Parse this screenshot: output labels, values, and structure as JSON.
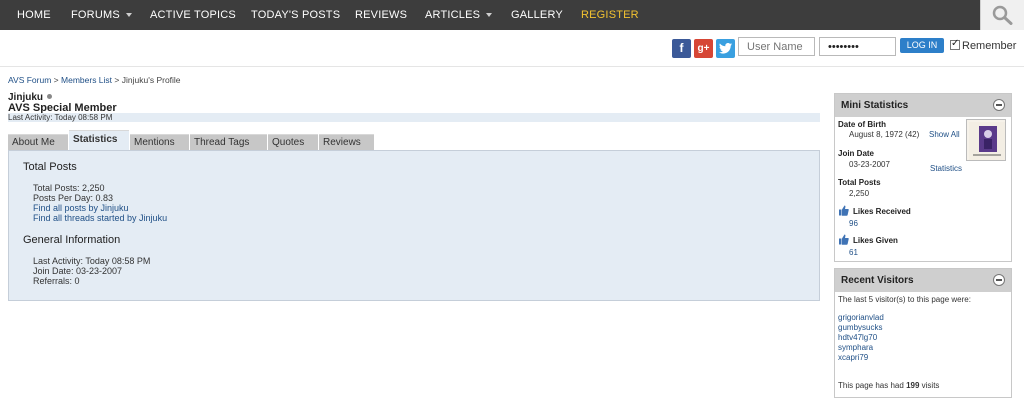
{
  "nav": {
    "items": [
      "HOME",
      "FORUMS",
      "ACTIVE TOPICS",
      "TODAY'S POSTS",
      "REVIEWS",
      "ARTICLES",
      "GALLERY",
      "REGISTER"
    ]
  },
  "login": {
    "username_placeholder": "User Name",
    "password_value": "••••••••",
    "login_label": "LOG IN",
    "remember_label": "Remember"
  },
  "breadcrumb": {
    "forum": "AVS Forum",
    "sep": ">",
    "members": "Members List",
    "current": "Jinjuku's Profile"
  },
  "profile": {
    "username": "Jinjuku",
    "title": "AVS Special Member",
    "last_activity": "Last Activity: Today 08:58 PM"
  },
  "tabs": [
    "About Me",
    "Statistics",
    "Mentions",
    "Thread Tags",
    "Quotes",
    "Reviews"
  ],
  "stats": {
    "total_posts_heading": "Total Posts",
    "total_posts": "Total Posts: 2,250",
    "posts_per_day": "Posts Per Day: 0.83",
    "find_posts": "Find all posts by Jinjuku",
    "find_threads": "Find all threads started by Jinjuku",
    "general_heading": "General Information",
    "last_activity": "Last Activity: Today 08:58 PM",
    "join_date": "Join Date: 03-23-2007",
    "referrals": "Referrals: 0"
  },
  "mini_stats": {
    "heading": "Mini Statistics",
    "dob_label": "Date of Birth",
    "dob_value": "August 8, 1972 (42)",
    "show_all": "Show All",
    "join_label": "Join Date",
    "join_value": "03-23-2007",
    "statistics_link": "Statistics",
    "posts_label": "Total Posts",
    "posts_value": "2,250",
    "likes_received_label": "Likes Received",
    "likes_received_value": "96",
    "likes_given_label": "Likes Given",
    "likes_given_value": "61"
  },
  "recent_visitors": {
    "heading": "Recent Visitors",
    "intro": "The last 5 visitor(s) to this page were:",
    "visitors": [
      "grigorianvlad",
      "gumbysucks",
      "hdtv47lg70",
      "symphara",
      "xcapri79"
    ],
    "visits_prefix": "This page has had",
    "visits_count": "199",
    "visits_suffix": "visits"
  },
  "colors": {
    "nav_bg": "#3d3d3d",
    "register": "#f2c230",
    "panel_bg": "#e4ecf4",
    "link": "#1f4f86",
    "login_button": "#2d7fc9"
  }
}
